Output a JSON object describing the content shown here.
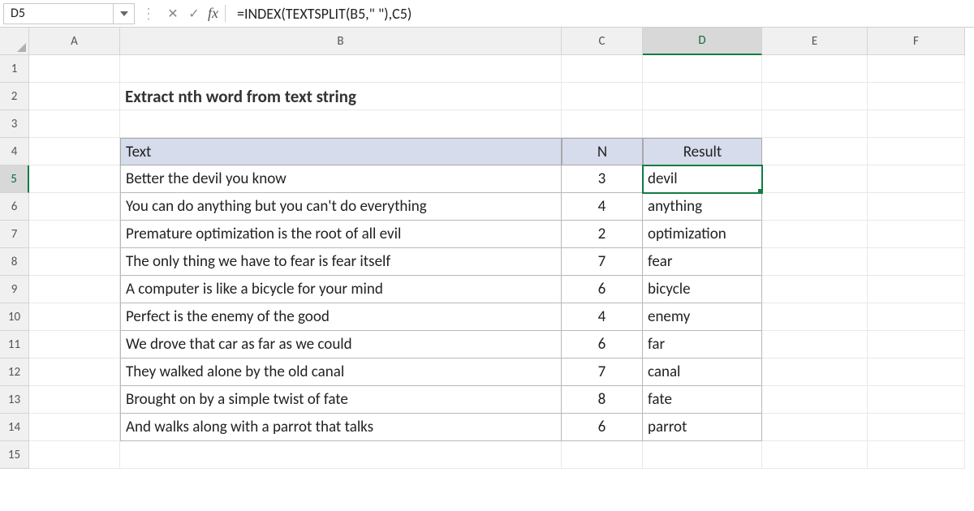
{
  "name_box": "D5",
  "formula": "=INDEX(TEXTSPLIT(B5,\" \"),C5)",
  "fx_label": "fx",
  "columns": [
    "A",
    "B",
    "C",
    "D",
    "E",
    "F"
  ],
  "row_labels": [
    "1",
    "2",
    "3",
    "4",
    "5",
    "6",
    "7",
    "8",
    "9",
    "10",
    "11",
    "12",
    "13",
    "14",
    "15"
  ],
  "selected_col": "D",
  "selected_row": "5",
  "title": "Extract nth word from text string",
  "headers": {
    "text": "Text",
    "n": "N",
    "result": "Result"
  },
  "rows": [
    {
      "text": "Better the devil you know",
      "n": "3",
      "result": "devil"
    },
    {
      "text": "You can do anything but you can't do everything",
      "n": "4",
      "result": "anything"
    },
    {
      "text": "Premature optimization is the root of all evil",
      "n": "2",
      "result": "optimization"
    },
    {
      "text": "The only thing we have to fear is fear itself",
      "n": "7",
      "result": "fear"
    },
    {
      "text": "A computer is like a bicycle for your mind",
      "n": "6",
      "result": "bicycle"
    },
    {
      "text": "Perfect is the enemy of the good",
      "n": "4",
      "result": "enemy"
    },
    {
      "text": "We drove that car as far as we could",
      "n": "6",
      "result": "far"
    },
    {
      "text": "They walked alone by the old canal",
      "n": "7",
      "result": "canal"
    },
    {
      "text": "Brought on by a simple twist of fate",
      "n": "8",
      "result": "fate"
    },
    {
      "text": "And walks along with a parrot that talks",
      "n": "6",
      "result": "parrot"
    }
  ]
}
